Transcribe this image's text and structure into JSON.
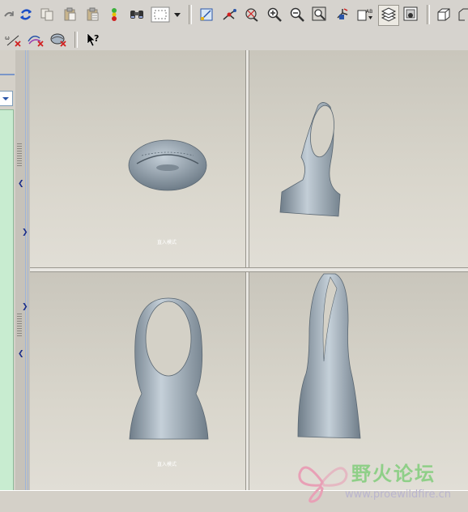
{
  "toolbar": {
    "row1_icons": [
      "redo-icon",
      "regenerate-icon",
      "copy-icon",
      "paste-icon",
      "paste-special-icon",
      "model-player-icon",
      "find-icon",
      "select-box-icon",
      "dropdown-arrow-icon",
      "sketch-view-icon",
      "datum-axis-icon",
      "spin-center-icon",
      "zoom-in-icon",
      "zoom-out-icon",
      "refit-icon",
      "reorient-icon",
      "saved-views-icon",
      "layers-icon",
      "view-manager-icon",
      "shading-icon"
    ],
    "row2_icons": [
      "measure-icon",
      "clear-analysis-icon",
      "delete-surface-icon",
      "context-help-icon"
    ]
  },
  "viewports": {
    "top_left": {
      "label": "直入模式"
    },
    "top_right": {
      "label": ""
    },
    "bottom_left": {
      "label": "直入模式"
    },
    "bottom_right": {
      "label": ""
    }
  },
  "watermark": {
    "title": "野火论坛",
    "url": "www.proewildfire.cn"
  },
  "colors": {
    "model": "#9aa7b1",
    "viewport_bg": "#d3d0c6",
    "left_panel": "#c8ecd0",
    "watermark_green": "#8fcf88"
  }
}
